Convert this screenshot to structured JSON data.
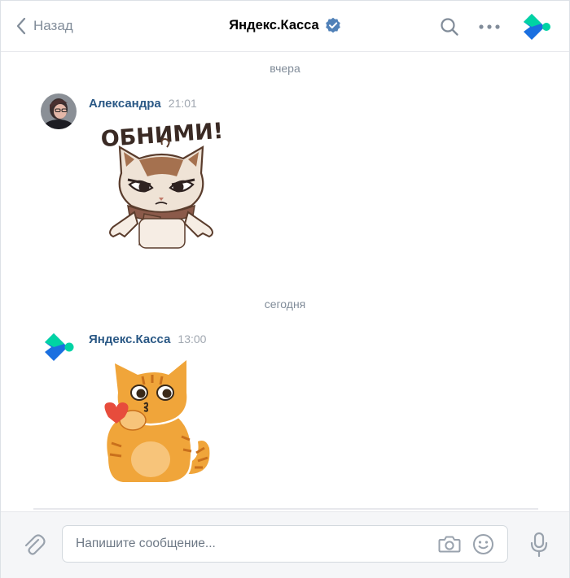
{
  "header": {
    "back_label": "Назад",
    "title": "Яндекс.Касса",
    "icons": [
      "chevron-left-icon",
      "verified-icon",
      "search-icon",
      "more-icon",
      "yandex-kassa-logo"
    ]
  },
  "messages": [
    {
      "date_separator": "вчера",
      "author": "Александра",
      "time": "21:01",
      "sticker_text": "ОБНИМИ!"
    },
    {
      "date_separator": "сегодня",
      "author": "Яндекс.Касса",
      "time": "13:00"
    }
  ],
  "composer": {
    "placeholder": "Напишите сообщение...",
    "icons": [
      "paperclip-icon",
      "camera-icon",
      "smile-icon",
      "microphone-icon"
    ]
  },
  "colors": {
    "link": "#2a5885",
    "muted": "#818c99",
    "verified": "#5181b8",
    "brand_blue": "#1a6fe0",
    "brand_green": "#00d3a4"
  }
}
